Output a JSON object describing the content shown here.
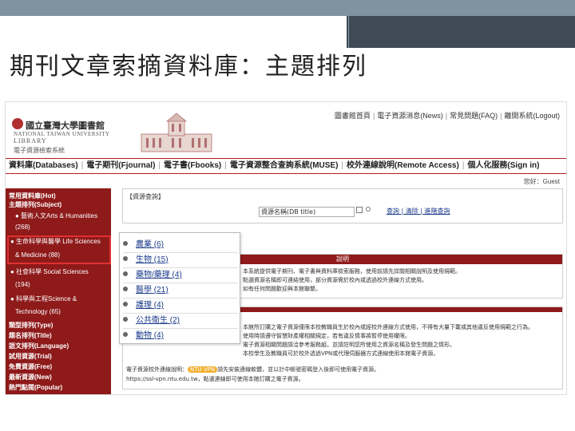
{
  "slide": {
    "title": "期刊文章索摘資料庫：主題排列"
  },
  "library": {
    "name_zh": "國立臺灣大學圖書館",
    "name_en_1": "NATIONAL TAIWAN UNIVERSITY",
    "name_en_2": "LIBRARY",
    "subtitle": "電子資源檢索系統"
  },
  "top_links": [
    "圖書館首頁",
    "電子資源消息(News)",
    "常見問題(FAQ)",
    "離開系統(Logout)"
  ],
  "navbar": [
    "資料庫(Databases)",
    "電子期刊(Fjournal)",
    "電子書(Fbooks)",
    "電子資源整合查詢系統(MUSE)",
    "校外連線說明(Remote Access)",
    "個人化服務(Sign in)"
  ],
  "guest": "您好：Guest",
  "sidebar": {
    "items": [
      {
        "label": "常用資料庫(Hot)",
        "bold": true
      },
      {
        "label": "主題排列(Subject)",
        "bold": true
      },
      {
        "label": "● 藝術人文Arts & Humanities",
        "bold": false
      },
      {
        "label": "(268)",
        "bold": false
      },
      {
        "label": "● 生命科學與醫學 Life Sciences",
        "bold": false
      },
      {
        "label": "& Medicine (88)",
        "bold": false
      },
      {
        "label": "● 社會科學 Social Sciences",
        "bold": false
      },
      {
        "label": "(194)",
        "bold": false
      },
      {
        "label": "● 科學與工程Science &",
        "bold": false
      },
      {
        "label": "Technology (65)",
        "bold": false
      },
      {
        "label": "類型排列(Type)",
        "bold": true
      },
      {
        "label": "題名排列(Title)",
        "bold": true
      },
      {
        "label": "語文排列(Language)",
        "bold": true
      },
      {
        "label": "試用資源(Trial)",
        "bold": true
      },
      {
        "label": "免費資源(Free)",
        "bold": true
      },
      {
        "label": "最新資源(New)",
        "bold": true
      },
      {
        "label": "熱門點閱(Popular)",
        "bold": true
      }
    ]
  },
  "search": {
    "title": "【資源查詢】",
    "field_value": "資源名稱(DB title)",
    "links": "查詢 | 清除 | 進階查詢"
  },
  "panel": {
    "head": "說明",
    "lines": [
      "本系統提供電子期刊、電子書與資料庫檢索服務，使用前請先詳閱相關說明及使用規範。",
      "點選資源名稱即可連結使用，部分資源需於校內或透過校外連線方式使用。",
      "如有任何問題歡迎與本館聯繫。"
    ]
  },
  "panel2": {
    "lines": [
      "本館所訂購之電子資源僅限本校教職員生於校內或經校外連線方式使用，不得有大量下載或其他違反使用規範之行為。",
      "使用時請遵守智慧財產權相關規定，若有違反情事將暫停使用權限。",
      "電子資源相關問題請洽參考服務組，並請註明您所使用之資源名稱及發生問題之情形。",
      "本校學生及教職員可於校外透過VPN或代理伺服器方式連線使用本館電子資源。"
    ],
    "vpn_line_prefix": "電子資源校外連線說明：",
    "vpn_badge": "NTU VPN",
    "vpn_line_suffix": "請先安裝連線軟體，並以計中帳號密碼登入後即可使用電子資源。",
    "url_line": "https://ssl-vpn.ntu.edu.tw，點選連線即可使用本館訂購之電子資源。"
  },
  "subjects": [
    {
      "label": "農業 (6)"
    },
    {
      "label": "生物 (15)"
    },
    {
      "label": "藥物/藥理 (4)"
    },
    {
      "label": "醫學 (21)"
    },
    {
      "label": "護理 (4)"
    },
    {
      "label": "公共衛生 (2)"
    },
    {
      "label": "動物 (4)"
    }
  ],
  "colors": {
    "brand_red": "#8e1a1a",
    "highlight_red": "#e03030",
    "link_blue": "#1a3a8a",
    "band_gray": "#7f93a0",
    "band_dark": "#3e4a55"
  }
}
